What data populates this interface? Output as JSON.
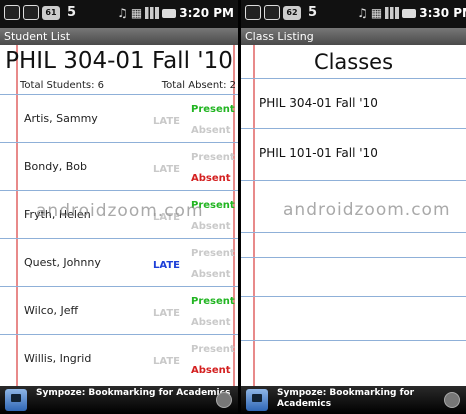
{
  "left": {
    "status": {
      "badge": "61",
      "num": "5",
      "time": "3:20 PM"
    },
    "title_bar": "Student List",
    "course": "PHIL 304-01 Fall '10",
    "total_students": "Total Students: 6",
    "total_absent": "Total Absent: 2",
    "late_label": "LATE",
    "present_label": "Present",
    "absent_label": "Absent",
    "students": [
      {
        "name": "Artis, Sammy",
        "late": false,
        "present": true,
        "absent": false
      },
      {
        "name": "Bondy, Bob",
        "late": false,
        "present": false,
        "absent": true
      },
      {
        "name": "Fryth, Helen",
        "late": false,
        "present": true,
        "absent": false
      },
      {
        "name": "Quest, Johnny",
        "late": true,
        "present": false,
        "absent": false
      },
      {
        "name": "Wilco, Jeff",
        "late": false,
        "present": true,
        "absent": false
      },
      {
        "name": "Willis, Ingrid",
        "late": false,
        "present": false,
        "absent": true
      }
    ],
    "watermark": "androidzoom.com",
    "footer": "Sympoze: Bookmarking for Academics"
  },
  "right": {
    "status": {
      "badge": "62",
      "num": "5",
      "time": "3:30 PM"
    },
    "title_bar": "Class Listing",
    "heading": "Classes",
    "classes": [
      "PHIL 304-01 Fall '10",
      "PHIL 101-01 Fall '10"
    ],
    "watermark": "androidzoom.com",
    "footer": "Sympoze: Bookmarking for Academics"
  },
  "colors": {
    "present": "#22b522",
    "absent": "#d42020",
    "late": "#1d3fd8",
    "rule": "#8fb0d8",
    "margin": "#e88a8a"
  }
}
